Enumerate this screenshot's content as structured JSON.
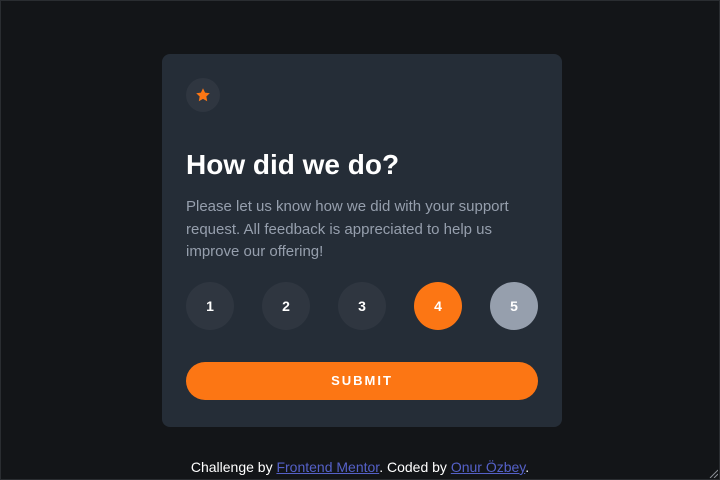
{
  "card": {
    "icon": "star-icon",
    "title": "How did we do?",
    "description": "Please let us know how we did with your support request. All feedback is appreciated to help us improve our offering!",
    "ratings": [
      "1",
      "2",
      "3",
      "4",
      "5"
    ],
    "selected_rating": "4",
    "hovered_rating": "5",
    "submit_label": "SUBMIT"
  },
  "footer": {
    "prefix": "Challenge by ",
    "link1": "Frontend Mentor",
    "middle": ". Coded by ",
    "link2": "Onur Özbey",
    "suffix": "."
  },
  "colors": {
    "background": "#131518",
    "card": "#252d37",
    "accent": "#fc7614",
    "muted": "#969fad",
    "circle": "#2f3640",
    "link": "#5561c8"
  }
}
